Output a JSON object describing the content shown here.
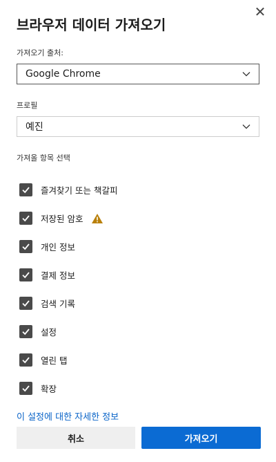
{
  "dialog": {
    "title": "브라우저 데이터 가져오기",
    "close_symbol": "✕"
  },
  "source": {
    "label": "가져오기 출처:",
    "selected": "Google Chrome"
  },
  "profile": {
    "label": "프로필",
    "selected": "예진"
  },
  "items": {
    "label": "가져올 항목 선택",
    "list": [
      {
        "label": "즐겨찾기 또는 책갈피",
        "checked": true
      },
      {
        "label": "저장된 암호",
        "checked": true,
        "icon": "warning-icon"
      },
      {
        "label": "개인 정보",
        "checked": true
      },
      {
        "label": "결제 정보",
        "checked": true
      },
      {
        "label": "검색 기록",
        "checked": true
      },
      {
        "label": "설정",
        "checked": true
      },
      {
        "label": "열린 탭",
        "checked": true
      },
      {
        "label": "확장",
        "checked": true
      }
    ]
  },
  "footer": {
    "more_info_link": "이 설정에 대한 자세한 정보",
    "cancel_label": "취소",
    "import_label": "가져오기"
  },
  "colors": {
    "accent": "#0b6bd3",
    "link": "#0a64c8",
    "warning": "#b9800a",
    "checkbox": "#4a4a4a"
  }
}
